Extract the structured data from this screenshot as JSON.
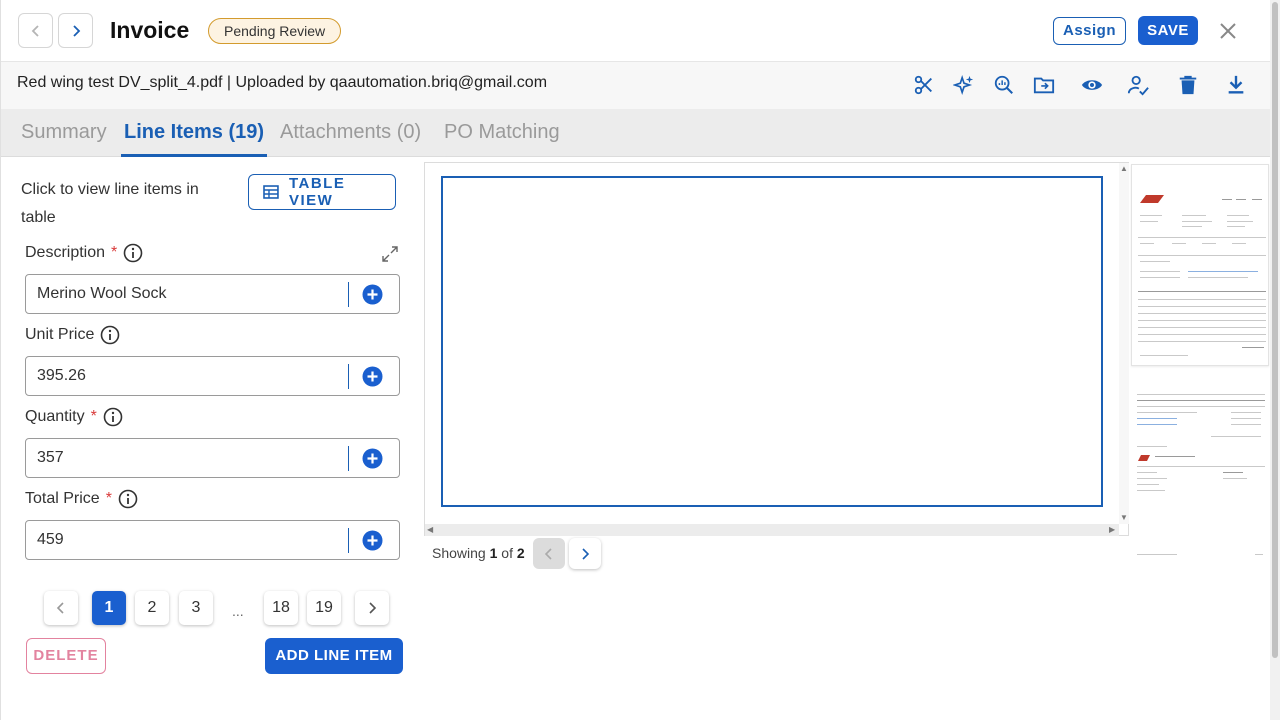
{
  "header": {
    "title": "Invoice",
    "status_badge": "Pending Review",
    "assign_label": "Assign",
    "save_label": "SAVE"
  },
  "file_bar": {
    "file_info": "Red wing test DV_split_4.pdf | Uploaded by qaautomation.briq@gmail.com",
    "tools": [
      "scissors-icon",
      "sparkle-icon",
      "zoom-analytics-icon",
      "move-folder-icon",
      "eye-icon",
      "user-check-icon",
      "trash-icon",
      "download-icon"
    ]
  },
  "tabs": [
    {
      "label": "Summary",
      "active": false
    },
    {
      "label": "Line Items (19)",
      "active": true
    },
    {
      "label": "Attachments (0)",
      "active": false
    },
    {
      "label": "PO Matching",
      "active": false
    }
  ],
  "left_panel": {
    "hint": "Click to view line items in table",
    "table_view_label": "TABLE VIEW",
    "fields": [
      {
        "label": "Description",
        "required": "*",
        "value": "Merino Wool Sock"
      },
      {
        "label": "Unit Price",
        "required": "",
        "value": "395.26"
      },
      {
        "label": "Quantity",
        "required": "*",
        "value": "357"
      },
      {
        "label": "Total Price",
        "required": "*",
        "value": "459"
      }
    ],
    "pagination": {
      "pages": [
        "1",
        "2",
        "3",
        "18",
        "19"
      ],
      "ellipsis": "...",
      "current": "1"
    },
    "delete_label": "DELETE",
    "add_line_label": "ADD LINE ITEM"
  },
  "viewer": {
    "showing_prefix": "Showing",
    "current_page": "1",
    "of_word": "of",
    "total_pages": "2"
  },
  "colors": {
    "accent": "#1a5fcf",
    "badge_border": "#d39b2d",
    "delete": "#e3839f",
    "required": "#d93a3a"
  }
}
